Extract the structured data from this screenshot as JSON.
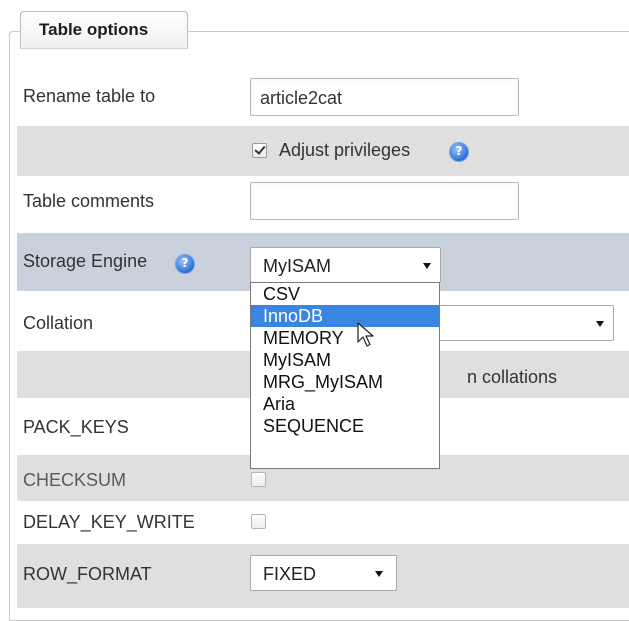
{
  "panel": {
    "title": "Table options"
  },
  "rows": {
    "rename": {
      "label": "Rename table to",
      "value": "article2cat"
    },
    "adjust_privileges": {
      "label": "Adjust privileges",
      "checked": true
    },
    "comments": {
      "label": "Table comments",
      "value": ""
    },
    "storage_engine": {
      "label": "Storage Engine",
      "selected": "MyISAM",
      "options": [
        "CSV",
        "InnoDB",
        "MEMORY",
        "MyISAM",
        "MRG_MyISAM",
        "Aria",
        "SEQUENCE"
      ],
      "highlighted": "InnoDB"
    },
    "collation": {
      "label": "Collation",
      "value": ""
    },
    "collation_note": {
      "visible_text": "n collations"
    },
    "pack_keys": {
      "label": "PACK_KEYS"
    },
    "checksum": {
      "label": "CHECKSUM",
      "checked": false
    },
    "delay_key_write": {
      "label": "DELAY_KEY_WRITE",
      "checked": false
    },
    "row_format": {
      "label": "ROW_FORMAT",
      "selected": "FIXED"
    }
  },
  "colors": {
    "highlight_row": "#c9d1dd",
    "alt_row": "#dfdfdf",
    "selected_option": "#3a85e0"
  },
  "icons": {
    "help": "help-icon",
    "dropdown_arrow": "chevron-down-icon",
    "cursor": "mouse-pointer-icon"
  }
}
